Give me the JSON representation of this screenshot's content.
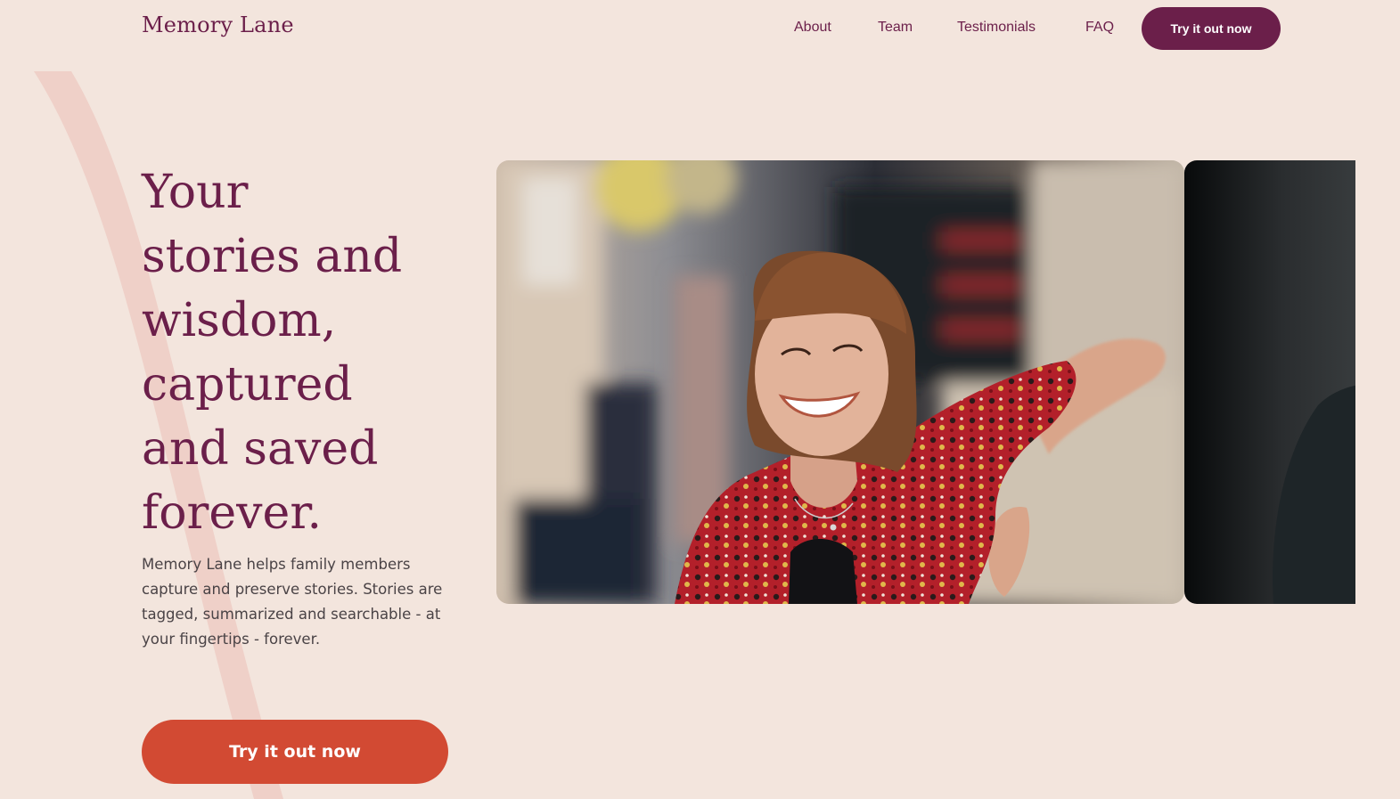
{
  "header": {
    "brand": "Memory Lane",
    "nav": {
      "about": "About",
      "team": "Team",
      "testimonials": "Testimonials",
      "faq": "FAQ"
    },
    "cta_label": "Try it out now"
  },
  "hero": {
    "title": "Your\nstories and\nwisdom,\ncaptured\nand saved\nforever.",
    "description": "Memory Lane helps family members capture and preserve stories. Stories are tagged, summarized and searchable - at your fingertips - forever.",
    "cta_label": "Try it out now"
  },
  "colors": {
    "background": "#f3e5dd",
    "brand": "#6b1f4a",
    "accent": "#d24a33",
    "decorative_arc": "#efd0c8"
  }
}
